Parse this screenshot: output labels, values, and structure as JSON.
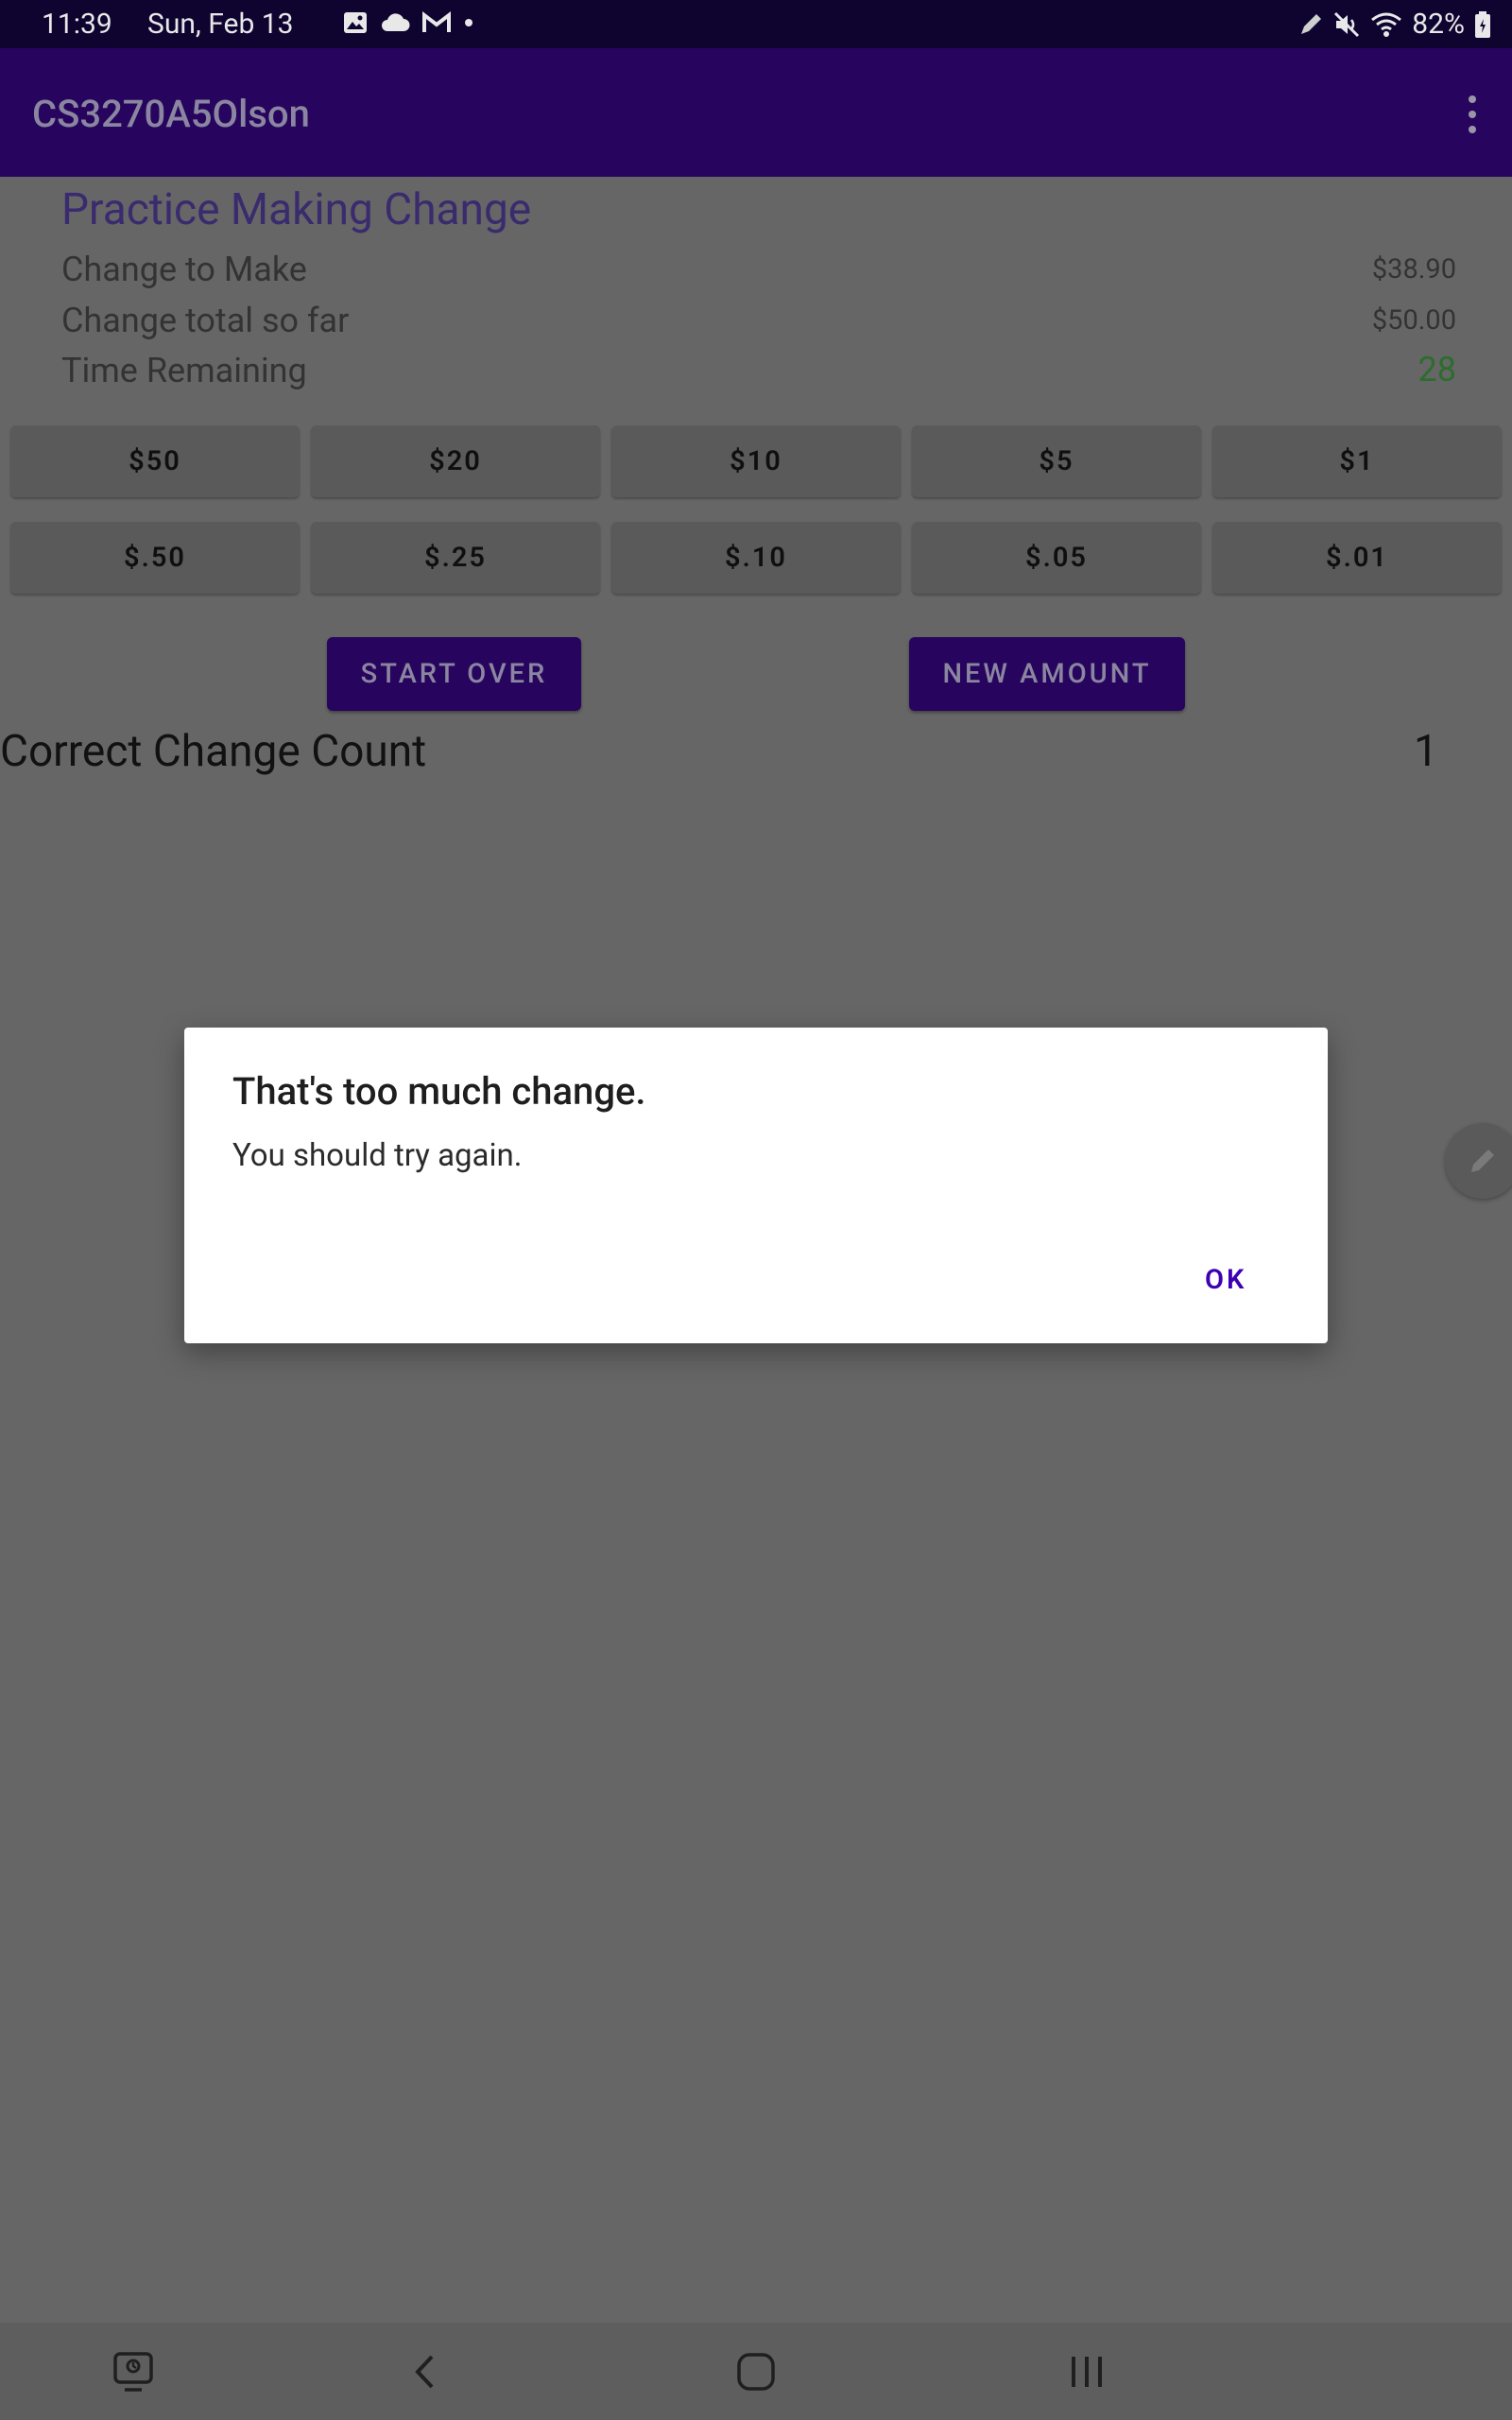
{
  "status_bar": {
    "time": "11:39",
    "date": "Sun, Feb 13",
    "battery": "82%",
    "icons": [
      "gallery-icon",
      "cloud-icon",
      "gmail-icon",
      "dot-icon",
      "pen-icon",
      "mute-icon",
      "wifi-icon",
      "battery-icon"
    ]
  },
  "app_bar": {
    "title": "CS3270A5Olson",
    "menu_icon": "overflow-menu-icon"
  },
  "main": {
    "heading": "Practice Making Change",
    "change_to_make_label": "Change to Make",
    "change_to_make_value": "$38.90",
    "change_total_label": "Change total so far",
    "change_total_value": "$50.00",
    "time_remaining_label": "Time Remaining",
    "time_remaining_value": "28",
    "bills": [
      "$50",
      "$20",
      "$10",
      "$5",
      "$1"
    ],
    "coins": [
      "$.50",
      "$.25",
      "$.10",
      "$.05",
      "$.01"
    ],
    "start_over": "START OVER",
    "new_amount": "NEW AMOUNT",
    "correct_count_label": "Correct Change Count",
    "correct_count_value": "1"
  },
  "dialog": {
    "title": "That's too much change.",
    "message": "You should try again.",
    "ok": "OK"
  },
  "colors": {
    "status_bar": "#0f0330",
    "app_bar": "#27055f",
    "accent": "#3d00b3",
    "green": "#2c6d2d",
    "scrim_background": "#666666"
  }
}
